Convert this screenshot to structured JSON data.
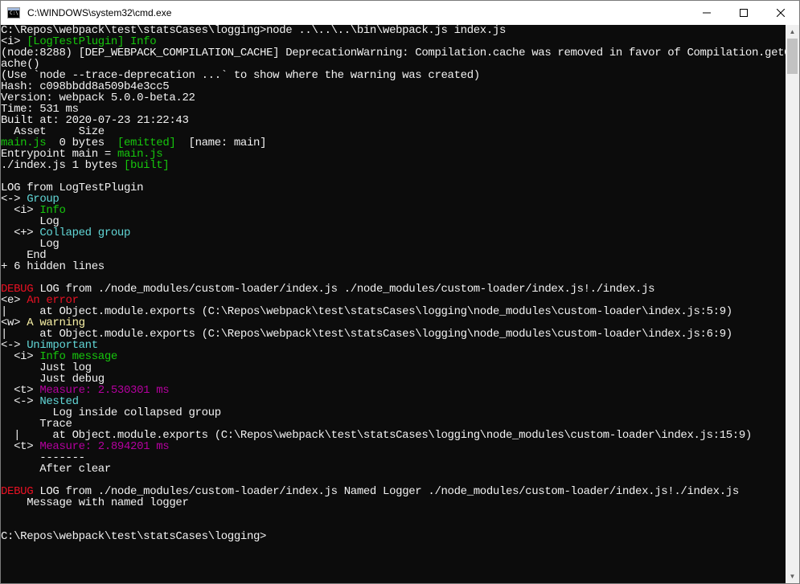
{
  "window": {
    "title": "C:\\WINDOWS\\system32\\cmd.exe",
    "icon_label": "C:\\"
  },
  "controls": {
    "minimize": "—",
    "maximize": "☐",
    "close": "✕"
  },
  "lines": [
    [
      {
        "t": "C:\\Repos\\webpack\\test\\statsCases\\logging>node ..\\..\\..\\bin\\webpack.js index.js",
        "c": "c-w"
      }
    ],
    [
      {
        "t": "<i> ",
        "c": "c-w"
      },
      {
        "t": "[LogTestPlugin] Info",
        "c": "c-g"
      }
    ],
    [
      {
        "t": "(node:8288) [DEP_WEBPACK_COMPILATION_CACHE] DeprecationWarning: Compilation.cache was removed in favor of Compilation.getC",
        "c": "c-w"
      }
    ],
    [
      {
        "t": "ache()",
        "c": "c-w"
      }
    ],
    [
      {
        "t": "(Use `node --trace-deprecation ...` to show where the warning was created)",
        "c": "c-w"
      }
    ],
    [
      {
        "t": "Hash: c098bbdd8a509b4e3cc5",
        "c": "c-w"
      }
    ],
    [
      {
        "t": "Version: webpack 5.0.0-beta.22",
        "c": "c-w"
      }
    ],
    [
      {
        "t": "Time: 531 ms",
        "c": "c-w"
      }
    ],
    [
      {
        "t": "Built at: 2020-07-23 ",
        "c": "c-w"
      },
      {
        "t": "21:22:43",
        "c": "c-w"
      }
    ],
    [
      {
        "t": "  Asset     Size",
        "c": "c-w"
      }
    ],
    [
      {
        "t": "main.js",
        "c": "c-g"
      },
      {
        "t": "  0 bytes  ",
        "c": "c-w"
      },
      {
        "t": "[emitted]",
        "c": "c-g"
      },
      {
        "t": "  [name: main]",
        "c": "c-w"
      }
    ],
    [
      {
        "t": "Entrypoint main = ",
        "c": "c-w"
      },
      {
        "t": "main.js",
        "c": "c-g"
      }
    ],
    [
      {
        "t": "./index.js 1 bytes ",
        "c": "c-w"
      },
      {
        "t": "[built]",
        "c": "c-g"
      }
    ],
    [
      {
        "t": "",
        "c": "c-w"
      }
    ],
    [
      {
        "t": "LOG from LogTestPlugin",
        "c": "c-w"
      }
    ],
    [
      {
        "t": "<-> ",
        "c": "c-w"
      },
      {
        "t": "Group",
        "c": "c-cy"
      }
    ],
    [
      {
        "t": "  <i> ",
        "c": "c-w"
      },
      {
        "t": "Info",
        "c": "c-g"
      }
    ],
    [
      {
        "t": "      Log",
        "c": "c-w"
      }
    ],
    [
      {
        "t": "  <+> ",
        "c": "c-w"
      },
      {
        "t": "Collaped group",
        "c": "c-cy"
      }
    ],
    [
      {
        "t": "      Log",
        "c": "c-w"
      }
    ],
    [
      {
        "t": "    End",
        "c": "c-w"
      }
    ],
    [
      {
        "t": "+ 6 hidden lines",
        "c": "c-w"
      }
    ],
    [
      {
        "t": "",
        "c": "c-w"
      }
    ],
    [
      {
        "t": "DEBUG",
        "c": "c-rb"
      },
      {
        "t": " LOG from ./node_modules/custom-loader/index.js ./node_modules/custom-loader/index.js!./index.js",
        "c": "c-w"
      }
    ],
    [
      {
        "t": "<e> ",
        "c": "c-w"
      },
      {
        "t": "An error",
        "c": "c-rb"
      }
    ],
    [
      {
        "t": "|     at Object.module.exports (C:\\Repos\\webpack\\test\\statsCases\\logging\\node_modules\\custom-loader\\index.js:5:9)",
        "c": "c-w"
      }
    ],
    [
      {
        "t": "<w> ",
        "c": "c-w"
      },
      {
        "t": "A warning",
        "c": "c-y"
      }
    ],
    [
      {
        "t": "|     at Object.module.exports (C:\\Repos\\webpack\\test\\statsCases\\logging\\node_modules\\custom-loader\\index.js:6:9)",
        "c": "c-w"
      }
    ],
    [
      {
        "t": "<-> ",
        "c": "c-w"
      },
      {
        "t": "Unimportant",
        "c": "c-cy"
      }
    ],
    [
      {
        "t": "  <i> ",
        "c": "c-w"
      },
      {
        "t": "Info message",
        "c": "c-g"
      }
    ],
    [
      {
        "t": "      Just log",
        "c": "c-w"
      }
    ],
    [
      {
        "t": "      Just debug",
        "c": "c-w"
      }
    ],
    [
      {
        "t": "  <t> ",
        "c": "c-w"
      },
      {
        "t": "Measure: 2.530301 ms",
        "c": "c-m2"
      }
    ],
    [
      {
        "t": "  <-> ",
        "c": "c-w"
      },
      {
        "t": "Nested",
        "c": "c-cy"
      }
    ],
    [
      {
        "t": "        Log inside collapsed group",
        "c": "c-w"
      }
    ],
    [
      {
        "t": "      Trace",
        "c": "c-w"
      }
    ],
    [
      {
        "t": "  |     at Object.module.exports (C:\\Repos\\webpack\\test\\statsCases\\logging\\node_modules\\custom-loader\\index.js:15:9)",
        "c": "c-w"
      }
    ],
    [
      {
        "t": "  <t> ",
        "c": "c-w"
      },
      {
        "t": "Measure: 2.894201 ms",
        "c": "c-m2"
      }
    ],
    [
      {
        "t": "      -------",
        "c": "c-w"
      }
    ],
    [
      {
        "t": "      After clear",
        "c": "c-w"
      }
    ],
    [
      {
        "t": "",
        "c": "c-w"
      }
    ],
    [
      {
        "t": "DEBUG",
        "c": "c-rb"
      },
      {
        "t": " LOG from ./node_modules/custom-loader/index.js Named Logger ./node_modules/custom-loader/index.js!./index.js",
        "c": "c-w"
      }
    ],
    [
      {
        "t": "    Message with named logger",
        "c": "c-w"
      }
    ],
    [
      {
        "t": "",
        "c": "c-w"
      }
    ],
    [
      {
        "t": "",
        "c": "c-w"
      }
    ],
    [
      {
        "t": "C:\\Repos\\webpack\\test\\statsCases\\logging>",
        "c": "c-w"
      }
    ]
  ],
  "scrollbar": {
    "up_arrow": "▲",
    "down_arrow": "▼"
  }
}
